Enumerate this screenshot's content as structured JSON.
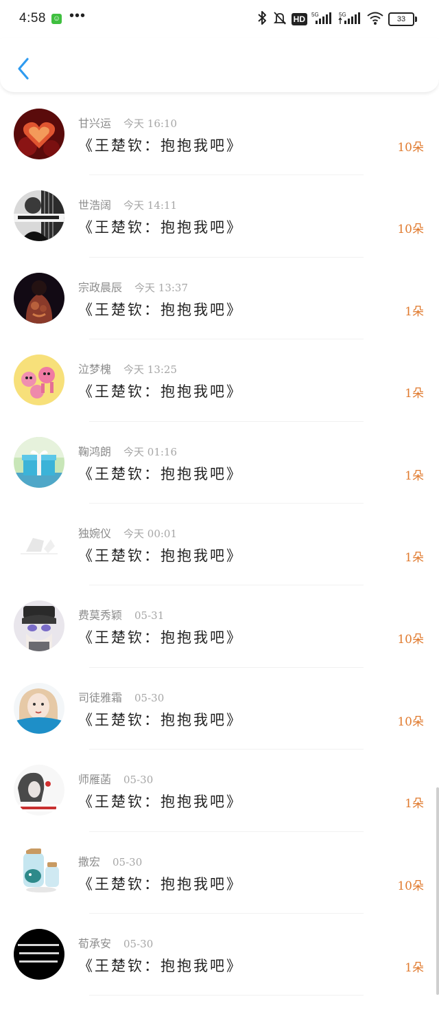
{
  "status_bar": {
    "time": "4:58",
    "app_badge": "☺",
    "dots": "•••",
    "network_label": "HD",
    "battery": "33",
    "icons": [
      "bluetooth-icon",
      "mute-icon",
      "signal-5g-icon",
      "wifi-icon",
      "battery-icon"
    ]
  },
  "nav": {
    "back_icon": "chevron-left-icon",
    "accent_color": "#2e9bf0"
  },
  "records": [
    {
      "name": "甘兴运",
      "time": "今天 16:10",
      "gift": "《王楚钦：抱抱我吧》",
      "count": "10朵",
      "avatar": "heart"
    },
    {
      "name": "世浩阔",
      "time": "今天 14:11",
      "gift": "《王楚钦：抱抱我吧》",
      "count": "10朵",
      "avatar": "bw"
    },
    {
      "name": "宗政晨辰",
      "time": "今天 13:37",
      "gift": "《王楚钦：抱抱我吧》",
      "count": "1朵",
      "avatar": "back"
    },
    {
      "name": "泣梦槐",
      "time": "今天 13:25",
      "gift": "《王楚钦：抱抱我吧》",
      "count": "1朵",
      "avatar": "cartoon"
    },
    {
      "name": "鞠鸿朗",
      "time": "今天 01:16",
      "gift": "《王楚钦：抱抱我吧》",
      "count": "1朵",
      "avatar": "giftbox"
    },
    {
      "name": "独婉仪",
      "time": "今天 00:01",
      "gift": "《王楚钦：抱抱我吧》",
      "count": "1朵",
      "avatar": "pale"
    },
    {
      "name": "费莫秀颖",
      "time": "05-31",
      "gift": "《王楚钦：抱抱我吧》",
      "count": "10朵",
      "avatar": "anime"
    },
    {
      "name": "司徒雅霜",
      "time": "05-30",
      "gift": "《王楚钦：抱抱我吧》",
      "count": "10朵",
      "avatar": "girl"
    },
    {
      "name": "师雁菡",
      "time": "05-30",
      "gift": "《王楚钦：抱抱我吧》",
      "count": "1朵",
      "avatar": "sketch"
    },
    {
      "name": "撒宏",
      "time": "05-30",
      "gift": "《王楚钦：抱抱我吧》",
      "count": "10朵",
      "avatar": "jar"
    },
    {
      "name": "荀承安",
      "time": "05-30",
      "gift": "《王楚钦：抱抱我吧》",
      "count": "1朵",
      "avatar": "text"
    }
  ],
  "colors": {
    "count": "#e07a2e",
    "name": "#8c8c8c"
  }
}
